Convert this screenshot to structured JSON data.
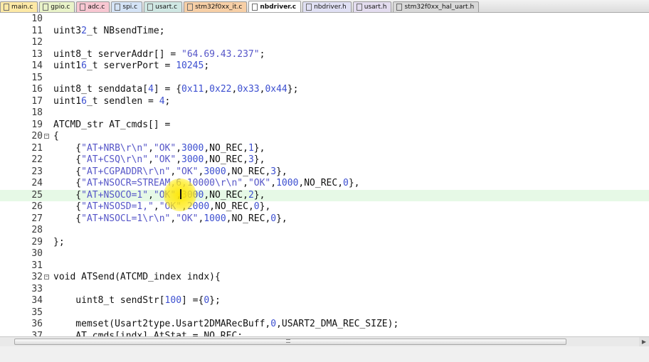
{
  "tabs": [
    {
      "label": "main.c",
      "cls": "t-main",
      "active": false
    },
    {
      "label": "gpio.c",
      "cls": "t-gpio",
      "active": false
    },
    {
      "label": "adc.c",
      "cls": "t-adc",
      "active": false
    },
    {
      "label": "spi.c",
      "cls": "t-spi",
      "active": false
    },
    {
      "label": "usart.c",
      "cls": "t-usart",
      "active": false
    },
    {
      "label": "stm32f0xx_it.c",
      "cls": "t-stmit",
      "active": false
    },
    {
      "label": "nbdriver.c",
      "cls": "t-nbc",
      "active": true
    },
    {
      "label": "nbdriver.h",
      "cls": "t-nbh",
      "active": false
    },
    {
      "label": "usart.h",
      "cls": "t-usarth",
      "active": false
    },
    {
      "label": "stm32f0xx_hal_uart.h",
      "cls": "t-hal",
      "active": false
    }
  ],
  "editor": {
    "highlighted_line": 25,
    "lines": [
      {
        "num": "10",
        "text": ""
      },
      {
        "num": "11",
        "text": "uint32_t NBsendTime;"
      },
      {
        "num": "12",
        "text": ""
      },
      {
        "num": "13",
        "text": "uint8_t serverAddr[] = \"64.69.43.237\";"
      },
      {
        "num": "14",
        "text": "uint16_t serverPort = 10245;"
      },
      {
        "num": "15",
        "text": ""
      },
      {
        "num": "16",
        "text": "uint8_t senddata[4] = {0x11,0x22,0x33,0x44};"
      },
      {
        "num": "17",
        "text": "uint16_t sendlen = 4;"
      },
      {
        "num": "18",
        "text": ""
      },
      {
        "num": "19",
        "text": "ATCMD_str AT_cmds[] ="
      },
      {
        "num": "20",
        "text": "{",
        "fold": true
      },
      {
        "num": "21",
        "text": "    {\"AT+NRB\\r\\n\",\"OK\",3000,NO_REC,1},"
      },
      {
        "num": "22",
        "text": "    {\"AT+CSQ\\r\\n\",\"OK\",3000,NO_REC,3},"
      },
      {
        "num": "23",
        "text": "    {\"AT+CGPADDR\\r\\n\",\"OK\",3000,NO_REC,3},"
      },
      {
        "num": "24",
        "text": "    {\"AT+NSOCR=STREAM,6,10000\\r\\n\",\"OK\",1000,NO_REC,0},"
      },
      {
        "num": "25",
        "text": "    {\"AT+NSOCO=1\",\"OK\",3000,NO_REC,2},"
      },
      {
        "num": "26",
        "text": "    {\"AT+NSOSD=1,\",\"OK\",2000,NO_REC,0},"
      },
      {
        "num": "27",
        "text": "    {\"AT+NSOCL=1\\r\\n\",\"OK\",1000,NO_REC,0},"
      },
      {
        "num": "28",
        "text": ""
      },
      {
        "num": "29",
        "text": "};"
      },
      {
        "num": "30",
        "text": ""
      },
      {
        "num": "31",
        "text": ""
      },
      {
        "num": "32",
        "text": "void ATSend(ATCMD_index indx){",
        "fold": true
      },
      {
        "num": "33",
        "text": ""
      },
      {
        "num": "34",
        "text": "    uint8_t sendStr[100] ={0};"
      },
      {
        "num": "35",
        "text": ""
      },
      {
        "num": "36",
        "text": "    memset(Usart2type.Usart2DMARecBuff,0,USART2_DMA_REC_SIZE);"
      },
      {
        "num": "37",
        "text": "    AT_cmds[indx].AtStat = NO_REC;"
      }
    ]
  },
  "icons": {
    "file": "file-icon",
    "fold": "fold-minus-icon",
    "scroll_right": "scroll-right-arrow-icon"
  }
}
